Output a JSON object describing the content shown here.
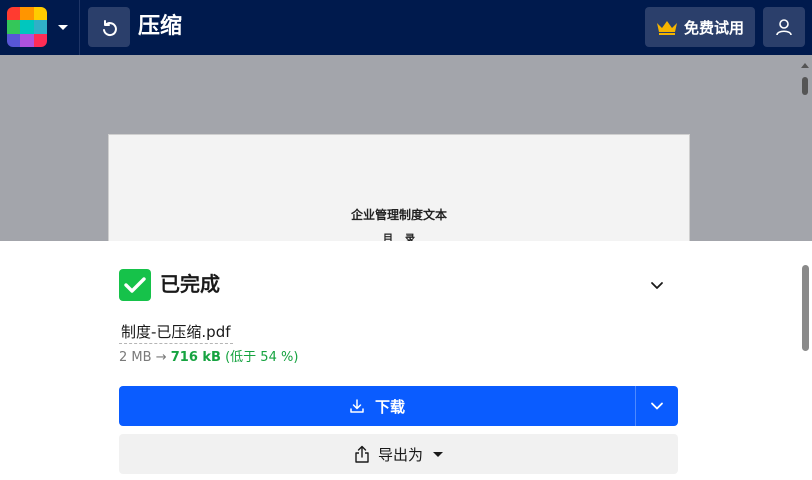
{
  "header": {
    "title": "压缩",
    "trial_label": "免费试用",
    "logo_colors": [
      "#ff3b30",
      "#ff9500",
      "#ffcc00",
      "#34c759",
      "#00c7be",
      "#30b0c7",
      "#5856d6",
      "#af52de",
      "#ff2d55"
    ]
  },
  "preview": {
    "doc_title": "企业管理制度文本",
    "doc_subtitle": "目录"
  },
  "result": {
    "status": "已完成",
    "file_name": "制度-已压缩.pdf",
    "original_size": "2 MB",
    "arrow": "→",
    "new_size": "716 kB",
    "reduction_text": "(低于 54 %)",
    "download_label": "下载",
    "export_label": "导出为"
  },
  "colors": {
    "topbar": "#001a4d",
    "primary": "#0a5cff",
    "success": "#16c24a"
  }
}
